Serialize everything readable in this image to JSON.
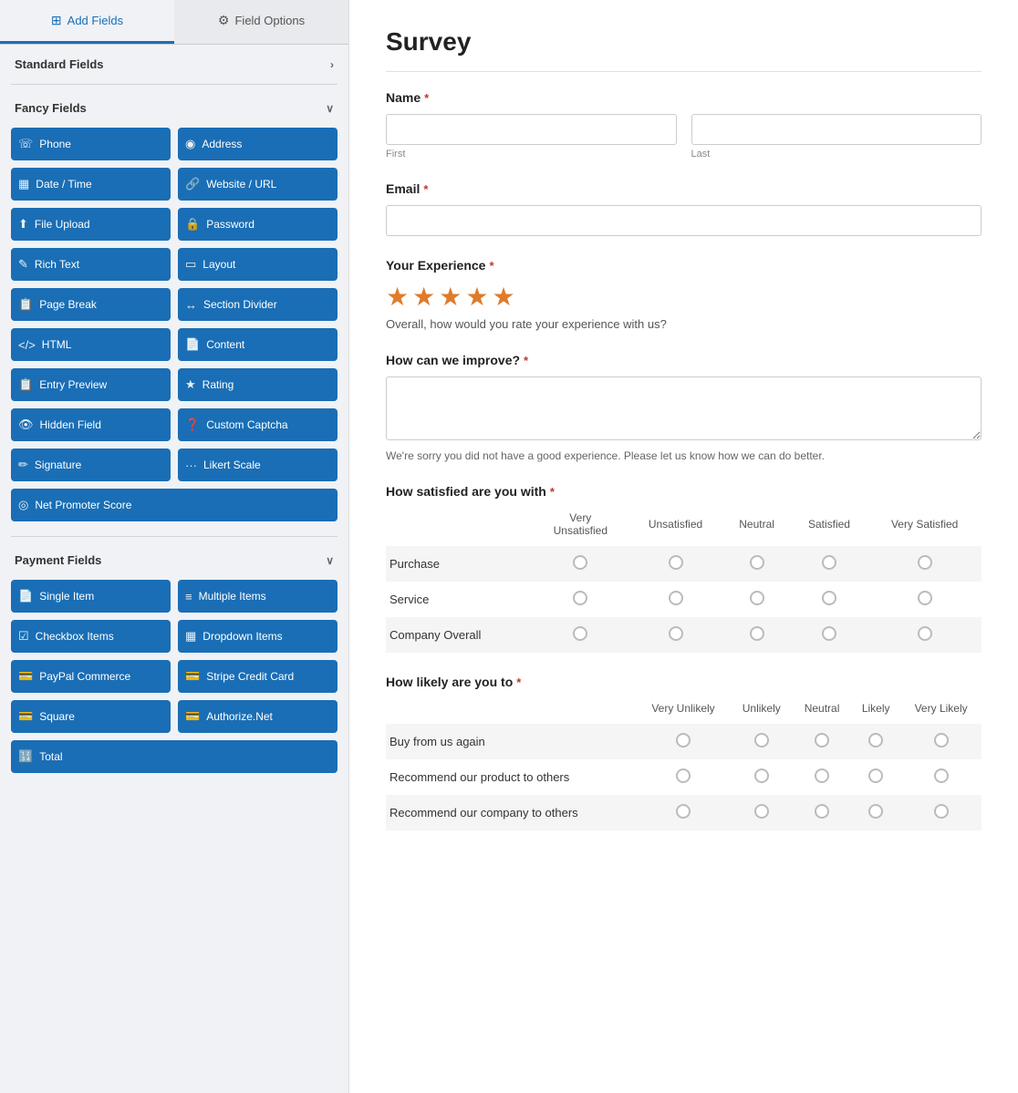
{
  "tabs": {
    "add_fields": "Add Fields",
    "field_options": "Field Options"
  },
  "sections": {
    "standard": {
      "label": "Standard Fields",
      "collapsed": false
    },
    "fancy": {
      "label": "Fancy Fields",
      "collapsed": false,
      "fields": [
        {
          "id": "phone",
          "label": "Phone",
          "icon": "📞"
        },
        {
          "id": "address",
          "label": "Address",
          "icon": "📍"
        },
        {
          "id": "datetime",
          "label": "Date / Time",
          "icon": "📅"
        },
        {
          "id": "website",
          "label": "Website / URL",
          "icon": "🔗"
        },
        {
          "id": "fileupload",
          "label": "File Upload",
          "icon": "⬆"
        },
        {
          "id": "password",
          "label": "Password",
          "icon": "🔒"
        },
        {
          "id": "richtext",
          "label": "Rich Text",
          "icon": "✏️"
        },
        {
          "id": "layout",
          "label": "Layout",
          "icon": "▭"
        },
        {
          "id": "pagebreak",
          "label": "Page Break",
          "icon": "📋"
        },
        {
          "id": "sectiondivider",
          "label": "Section Divider",
          "icon": "↔"
        },
        {
          "id": "html",
          "label": "HTML",
          "icon": "</>"
        },
        {
          "id": "content",
          "label": "Content",
          "icon": "📄"
        },
        {
          "id": "entrypreview",
          "label": "Entry Preview",
          "icon": "📋"
        },
        {
          "id": "rating",
          "label": "Rating",
          "icon": "⭐"
        },
        {
          "id": "hiddenfield",
          "label": "Hidden Field",
          "icon": "👁"
        },
        {
          "id": "customcaptcha",
          "label": "Custom Captcha",
          "icon": "❓"
        },
        {
          "id": "signature",
          "label": "Signature",
          "icon": "✏"
        },
        {
          "id": "likertscale",
          "label": "Likert Scale",
          "icon": "···"
        },
        {
          "id": "netpromoter",
          "label": "Net Promoter Score",
          "icon": "◎"
        }
      ]
    },
    "payment": {
      "label": "Payment Fields",
      "collapsed": false,
      "fields": [
        {
          "id": "singleitem",
          "label": "Single Item",
          "icon": "📄"
        },
        {
          "id": "multipleitems",
          "label": "Multiple Items",
          "icon": "≡"
        },
        {
          "id": "checkboxitems",
          "label": "Checkbox Items",
          "icon": "☑"
        },
        {
          "id": "dropdownitems",
          "label": "Dropdown Items",
          "icon": "▦"
        },
        {
          "id": "paypalcommerce",
          "label": "PayPal Commerce",
          "icon": "💳"
        },
        {
          "id": "stripecreditcard",
          "label": "Stripe Credit Card",
          "icon": "💳"
        },
        {
          "id": "square",
          "label": "Square",
          "icon": "💳"
        },
        {
          "id": "authorizenet",
          "label": "Authorize.Net",
          "icon": "💳"
        },
        {
          "id": "total",
          "label": "Total",
          "icon": "🔢"
        }
      ]
    }
  },
  "form": {
    "title": "Survey",
    "fields": {
      "name_label": "Name",
      "name_first_placeholder": "",
      "name_last_placeholder": "",
      "name_first_sub": "First",
      "name_last_sub": "Last",
      "email_label": "Email",
      "experience_label": "Your Experience",
      "experience_desc": "Overall, how would you rate your experience with us?",
      "improve_label": "How can we improve?",
      "improve_desc": "We're sorry you did not have a good experience. Please let us know how we can do better.",
      "satisfied_label": "How satisfied are you with",
      "likely_label": "How likely are you to"
    },
    "satisfied_cols": [
      "Very Unsatisfied",
      "Unsatisfied",
      "Neutral",
      "Satisfied",
      "Very Satisfied"
    ],
    "satisfied_rows": [
      "Purchase",
      "Service",
      "Company Overall"
    ],
    "likely_cols": [
      "Very Unlikely",
      "Unlikely",
      "Neutral",
      "Likely",
      "Very Likely"
    ],
    "likely_rows": [
      "Buy from us again",
      "Recommend our product to others",
      "Recommend our company to others"
    ]
  }
}
